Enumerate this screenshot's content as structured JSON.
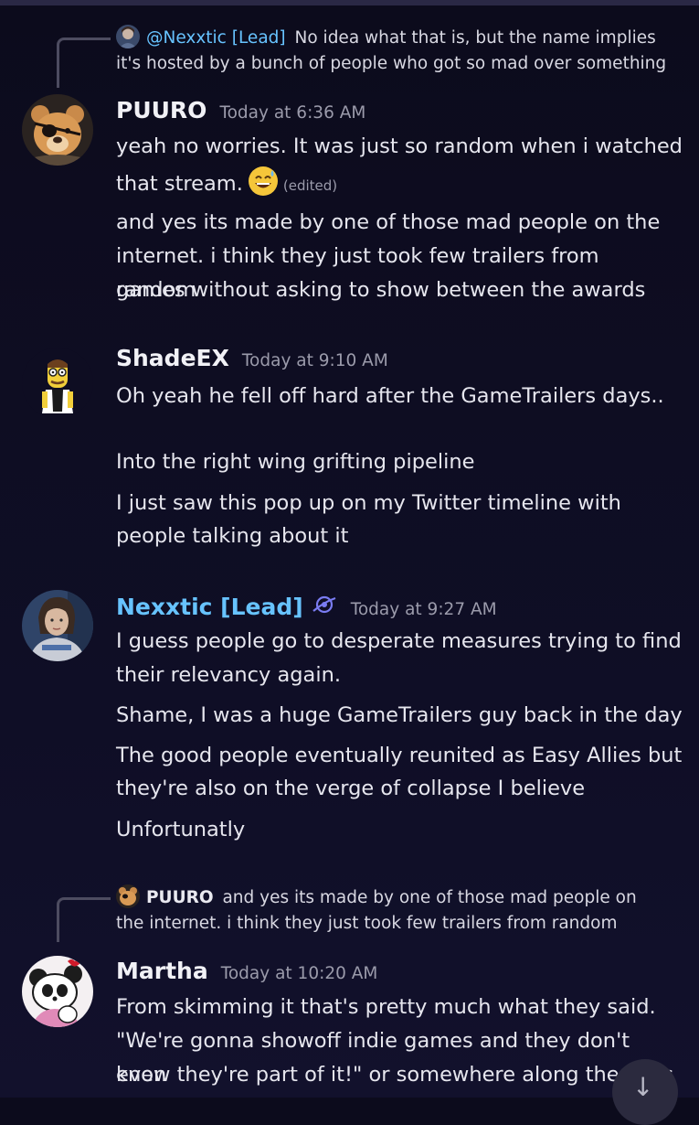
{
  "colors": {
    "background": "#0e0d22",
    "mention_name": "#67c3ff",
    "timestamp": "#9b9bab",
    "text": "#e6e6ee"
  },
  "messages": [
    {
      "reply": {
        "author": "@Nexxtic [Lead]",
        "lines": [
          "No idea what that is, but the name implies",
          "it's hosted by a bunch of people who got so mad over something"
        ]
      },
      "author": "PUURO",
      "avatar_icon": "bear-avatar-icon",
      "timestamp": "Today at 6:36 AM",
      "lines": [
        "yeah no worries. It was just so random when i watched",
        "that stream.",
        "and yes its made by one of those mad people on the",
        "internet. i think they just took few trailers from random",
        "games without asking to show between the awards"
      ],
      "edited_label": "(edited)",
      "emoji_icon": "sweat-smile-emoji-icon"
    },
    {
      "author": "ShadeEX",
      "avatar_icon": "cartoon-character-avatar-icon",
      "timestamp": "Today at 9:10 AM",
      "lines": [
        "Oh yeah he fell off hard after the GameTrailers days..",
        "Into the right wing grifting pipeline",
        "I just saw this pop up on my Twitter timeline with",
        "people talking about it"
      ]
    },
    {
      "author": "Nexxtic [Lead]",
      "avatar_icon": "sci-fi-character-avatar-icon",
      "badge_icon": "planet-badge-icon",
      "timestamp": "Today at 9:27 AM",
      "lines": [
        "I guess people go to desperate measures trying to find",
        "their relevancy again.",
        "Shame, I was a huge GameTrailers guy back in the day",
        "The good people eventually reunited as Easy Allies but",
        "they're  also on the verge of collapse I believe",
        "Unfortunatly"
      ]
    },
    {
      "reply": {
        "author": "PUURO",
        "lines": [
          "and yes its made by one of those mad people on",
          "the internet. i think they just took few trailers from random"
        ]
      },
      "author": "Martha",
      "avatar_icon": "panda-avatar-icon",
      "timestamp": "Today at 10:20 AM",
      "lines": [
        "From skimming it that's pretty much what they said.",
        "\"We're gonna showoff indie games and they don't even",
        "know they're part of it!\" or somewhere along the lines"
      ]
    }
  ],
  "scroll_button_icon": "jump-to-bottom-icon"
}
